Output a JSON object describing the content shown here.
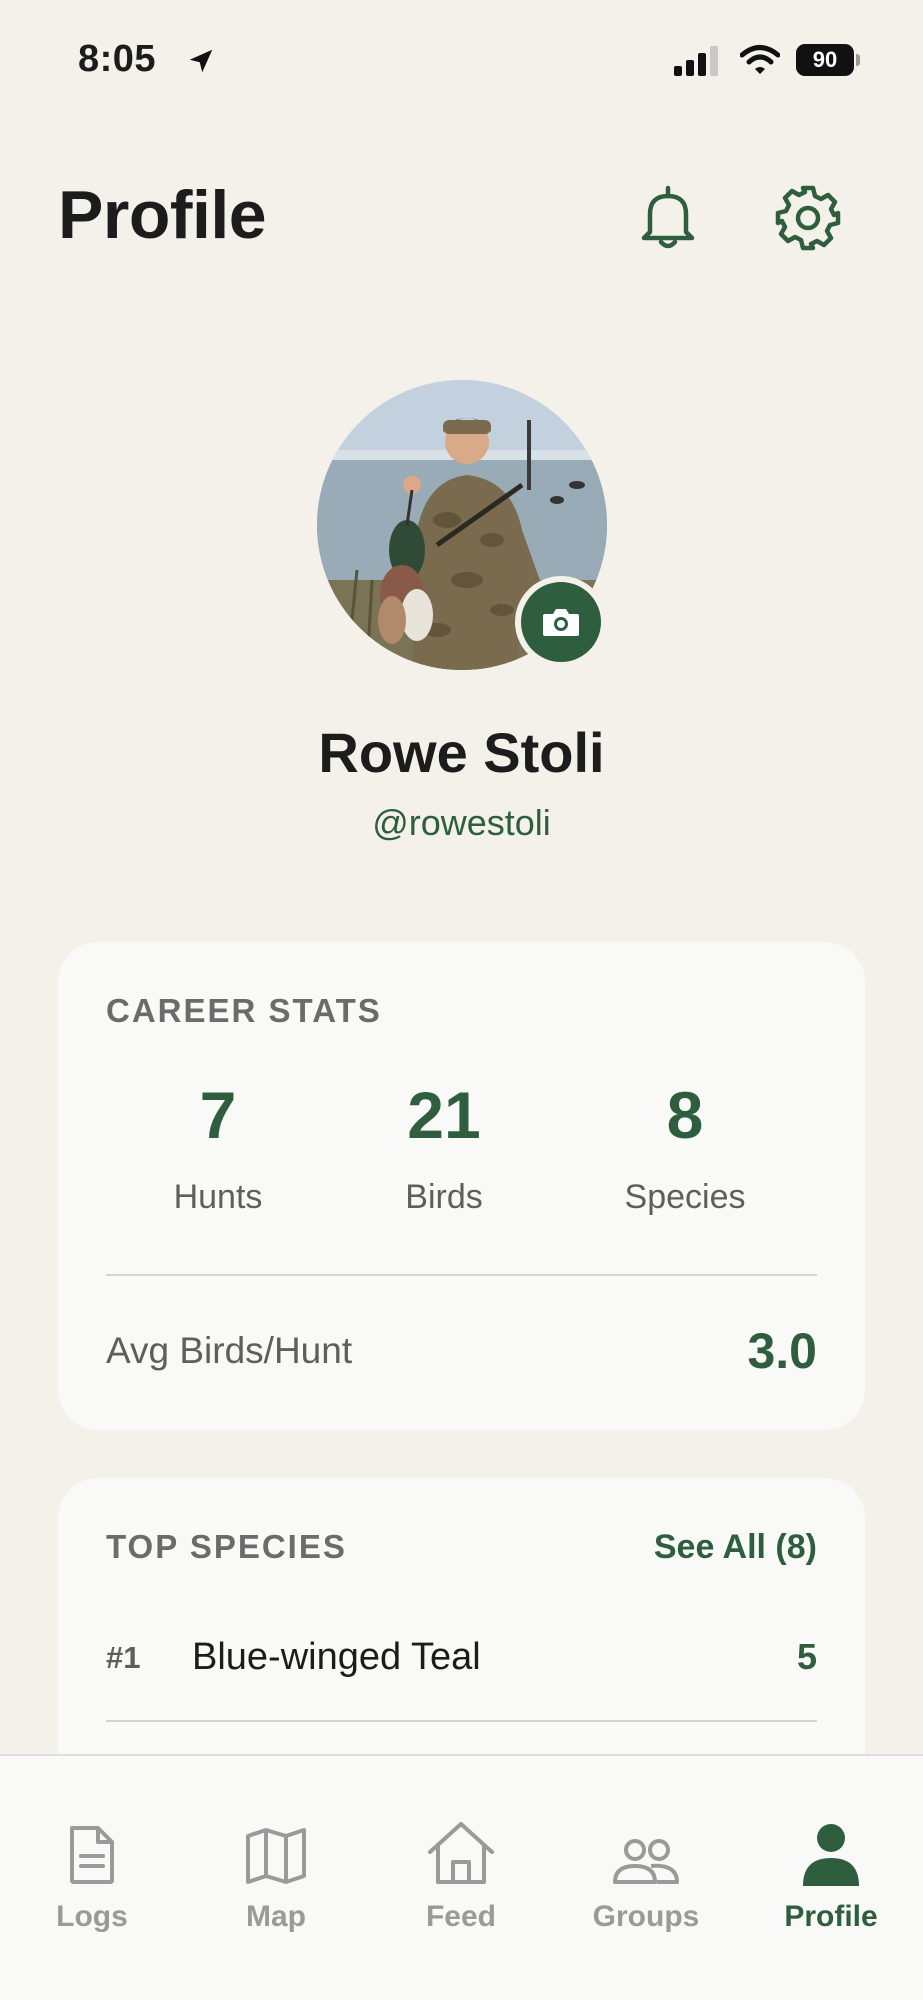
{
  "status_bar": {
    "time": "8:05",
    "battery": "90"
  },
  "header": {
    "title": "Profile"
  },
  "profile": {
    "name": "Rowe Stoli",
    "handle": "@rowestoli"
  },
  "career_stats": {
    "title": "CAREER STATS",
    "stats": [
      {
        "value": "7",
        "label": "Hunts"
      },
      {
        "value": "21",
        "label": "Birds"
      },
      {
        "value": "8",
        "label": "Species"
      }
    ],
    "avg_label": "Avg Birds/Hunt",
    "avg_value": "3.0"
  },
  "top_species": {
    "title": "TOP SPECIES",
    "see_all": "See All (8)",
    "items": [
      {
        "rank": "#1",
        "name": "Blue-winged Teal",
        "count": "5"
      }
    ]
  },
  "tabs": [
    {
      "label": "Logs",
      "icon": "document-icon"
    },
    {
      "label": "Map",
      "icon": "map-icon"
    },
    {
      "label": "Feed",
      "icon": "home-icon"
    },
    {
      "label": "Groups",
      "icon": "users-icon"
    },
    {
      "label": "Profile",
      "icon": "person-icon",
      "active": true
    }
  ],
  "colors": {
    "accent": "#2e5e3e",
    "background": "#f4f1eb",
    "card": "#f9f9f8"
  }
}
